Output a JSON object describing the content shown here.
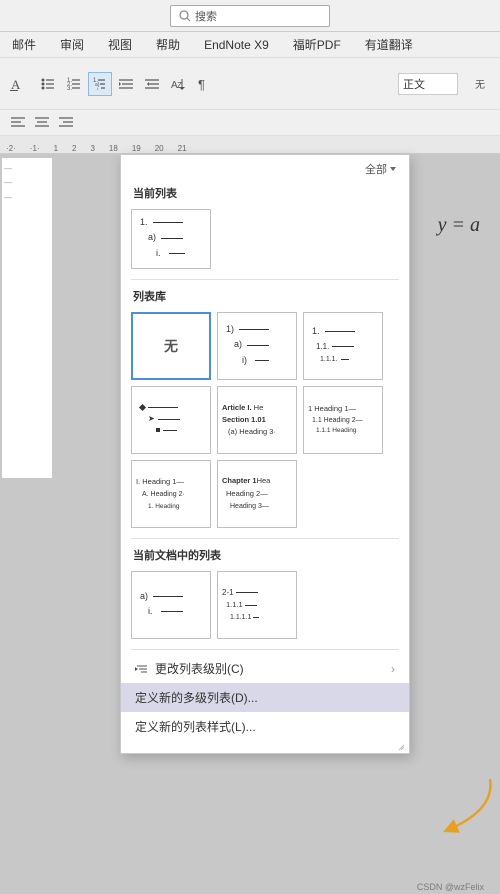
{
  "titlebar": {
    "search_placeholder": "搜索"
  },
  "menubar": {
    "items": [
      "邮件",
      "审阅",
      "视图",
      "帮助",
      "EndNote X9",
      "福昕PDF",
      "有道翻译"
    ]
  },
  "toolbar": {
    "style_label": "正文",
    "filter_label": "全部"
  },
  "panel": {
    "current_list_label": "当前列表",
    "list_library_label": "列表库",
    "document_list_label": "当前文档中的列表",
    "filter_label": "全部",
    "no_style_label": "无",
    "bottom_items": [
      {
        "label": "更改列表级别(C)",
        "icon": "indent",
        "has_arrow": true
      },
      {
        "label": "定义新的多级列表(D)...",
        "icon": "",
        "has_arrow": false,
        "highlighted": true
      },
      {
        "label": "定义新的列表样式(L)...",
        "icon": "",
        "has_arrow": false
      }
    ]
  },
  "formula": {
    "text": "y = a"
  },
  "watermark": {
    "text": "CSDN @wzFelix"
  },
  "ruler": {
    "ticks": [
      "-1",
      "1",
      "2",
      "3"
    ]
  }
}
